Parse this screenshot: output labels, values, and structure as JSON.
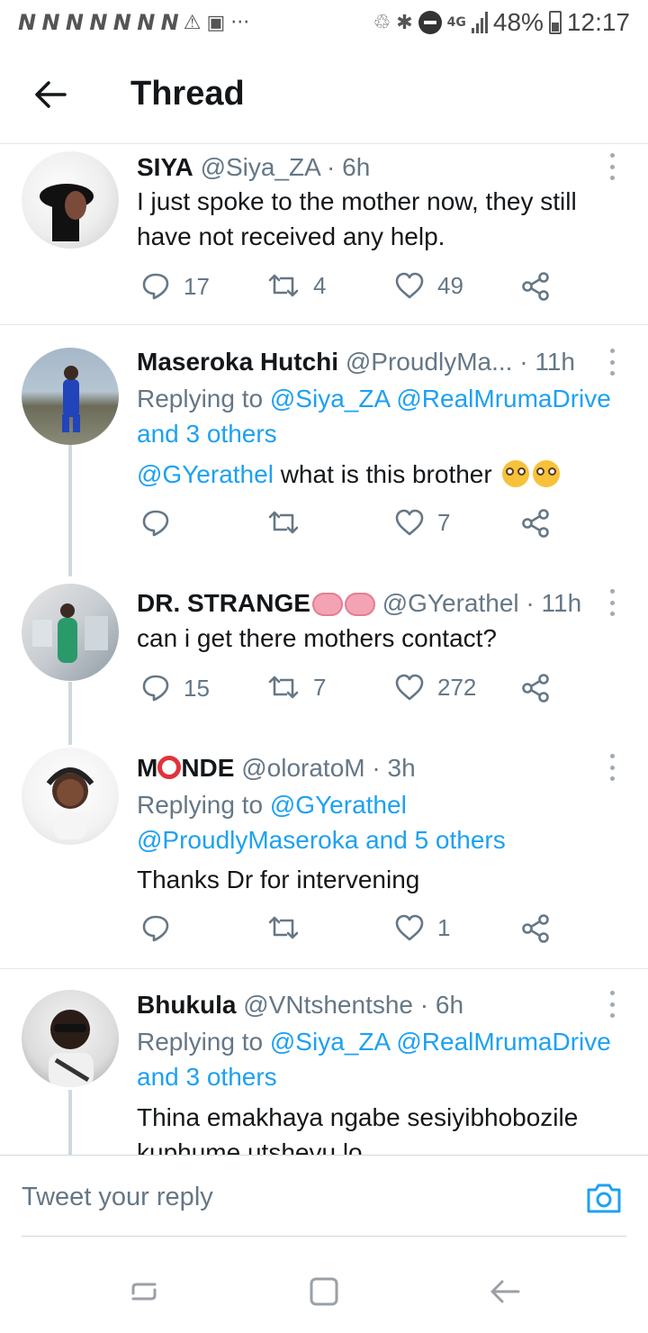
{
  "status_bar": {
    "notif_n": "N N N N N N N",
    "network": "4G",
    "battery": "48%",
    "time": "12:17"
  },
  "header": {
    "title": "Thread",
    "back_icon": "arrow-left-icon"
  },
  "tweets": [
    {
      "name": "SIYA",
      "handle": "@Siya_ZA",
      "sep": "·",
      "time": "6h",
      "reply_prefix": "",
      "text": "I just spoke to the mother now, they still have not received any help.",
      "replies": "17",
      "retweets": "4",
      "likes": "49"
    },
    {
      "name": "Maseroka Hutchi",
      "handle": "@ProudlyMa...",
      "sep": "·",
      "time": "11h",
      "reply_prefix": "Replying to",
      "reply_targets": "@Siya_ZA @RealMrumaDrive and 3 others",
      "mention": "@GYerathel",
      "text": "what is this brother",
      "replies": "",
      "retweets": "",
      "likes": "7"
    },
    {
      "name": "DR. STRANGE",
      "handle": "@GYerathel",
      "sep": "·",
      "time": "11h",
      "text": "can i get there mothers contact?",
      "replies": "15",
      "retweets": "7",
      "likes": "272"
    },
    {
      "name_a": "M",
      "name_b": "NDE",
      "handle": "@oloratoM",
      "sep": "·",
      "time": "3h",
      "reply_prefix": "Replying to",
      "reply_targets": "@GYerathel @ProudlyMaseroka and 5 others",
      "text": "Thanks Dr for intervening",
      "replies": "",
      "retweets": "",
      "likes": "1"
    },
    {
      "name": "Bhukula",
      "handle": "@VNtshentshe",
      "sep": "·",
      "time": "6h",
      "reply_prefix": "Replying to",
      "reply_targets": "@Siya_ZA @RealMrumaDrive and 3 others",
      "text": "Thina emakhaya ngabe sesiyibhobozile kuphume utshevu lo"
    }
  ],
  "reply_bar": {
    "placeholder": "Tweet your reply",
    "camera_icon": "camera-icon"
  },
  "nav_bar": {
    "recent_icon": "recent-apps-icon",
    "home_icon": "home-icon",
    "back_icon": "nav-back-icon"
  },
  "colors": {
    "accent": "#1da1f2",
    "text": "#14171a",
    "muted": "#657786",
    "divider": "#e1e8ed"
  }
}
